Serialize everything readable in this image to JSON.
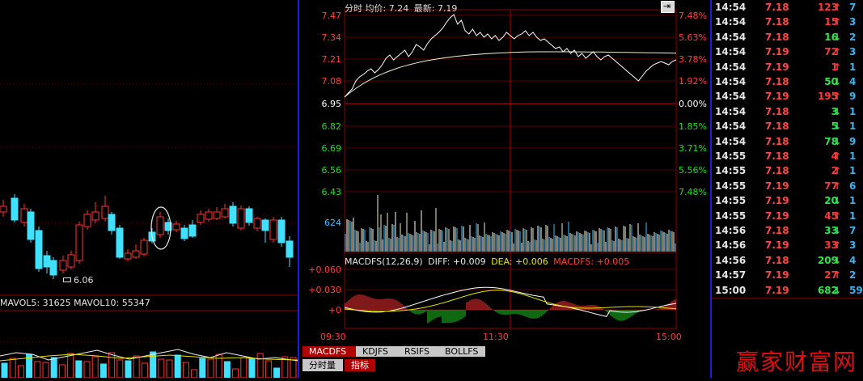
{
  "left_panel": {
    "price_label": "6.06",
    "volume_label": "MAVOL5: 31625 MAVOL10: 55347"
  },
  "intraday": {
    "header": {
      "label_fenshi": "分时",
      "avg_label": "均价:",
      "avg_value": "7.24",
      "last_label": "最新:",
      "last_value": "7.19"
    },
    "price_axis_left": [
      "7.47",
      "7.34",
      "7.21",
      "7.08",
      "6.95",
      "6.82",
      "6.69",
      "6.56",
      "6.43"
    ],
    "price_axis_right": [
      "7.48%",
      "5.63%",
      "3.78%",
      "1.92%",
      "0.00%",
      "1.85%",
      "3.71%",
      "5.56%",
      "7.48%"
    ],
    "volume_axis_label": "624",
    "macd_header": {
      "name": "MACDFS(12,26,9)",
      "diff": "DIFF: +0.009",
      "dea": "DEA: +0.006",
      "macdfs": "MACDFS: +0.005"
    },
    "macd_axis": [
      "+0.060",
      "+0.030",
      "+0"
    ],
    "time_axis": [
      "09:30",
      "11:30",
      "15:00"
    ],
    "indicator_tabs": [
      "MACDFS",
      "KDJFS",
      "RSIFS",
      "BOLLFS"
    ],
    "bottom_tabs": [
      "分时量",
      "指标"
    ],
    "colors": {
      "up": "#ff3232",
      "down": "#00e000",
      "grid": "#8a0000",
      "price_line": "#ffffff",
      "avg_line": "#ffff60"
    }
  },
  "trades": [
    {
      "time": "14:54",
      "price": "7.18",
      "vol": "123",
      "dir": "up",
      "count": "7"
    },
    {
      "time": "14:54",
      "price": "7.18",
      "vol": "15",
      "dir": "up",
      "count": "3"
    },
    {
      "time": "14:54",
      "price": "7.18",
      "vol": "16",
      "dir": "down",
      "count": "2"
    },
    {
      "time": "14:54",
      "price": "7.19",
      "vol": "72",
      "dir": "up",
      "count": "3"
    },
    {
      "time": "14:54",
      "price": "7.19",
      "vol": "1",
      "dir": "up",
      "count": "1"
    },
    {
      "time": "14:54",
      "price": "7.18",
      "vol": "50",
      "dir": "down",
      "count": "4"
    },
    {
      "time": "14:54",
      "price": "7.19",
      "vol": "195",
      "dir": "up",
      "count": "9"
    },
    {
      "time": "14:54",
      "price": "7.18",
      "vol": "3",
      "dir": "down",
      "count": "1"
    },
    {
      "time": "14:54",
      "price": "7.18",
      "vol": "5",
      "dir": "down",
      "count": "1"
    },
    {
      "time": "14:54",
      "price": "7.18",
      "vol": "78",
      "dir": "down",
      "count": "9"
    },
    {
      "time": "14:55",
      "price": "7.18",
      "vol": "4",
      "dir": "up",
      "count": "1"
    },
    {
      "time": "14:55",
      "price": "7.18",
      "vol": "2",
      "dir": "up",
      "count": "1"
    },
    {
      "time": "14:55",
      "price": "7.19",
      "vol": "77",
      "dir": "up",
      "count": "6"
    },
    {
      "time": "14:55",
      "price": "7.19",
      "vol": "20",
      "dir": "down",
      "count": "1"
    },
    {
      "time": "14:55",
      "price": "7.19",
      "vol": "45",
      "dir": "up",
      "count": "1"
    },
    {
      "time": "14:56",
      "price": "7.18",
      "vol": "33",
      "dir": "down",
      "count": "7"
    },
    {
      "time": "14:56",
      "price": "7.19",
      "vol": "33",
      "dir": "up",
      "count": "3"
    },
    {
      "time": "14:56",
      "price": "7.18",
      "vol": "209",
      "dir": "down",
      "count": "4"
    },
    {
      "time": "14:57",
      "price": "7.19",
      "vol": "27",
      "dir": "up",
      "count": "2"
    },
    {
      "time": "15:00",
      "price": "7.19",
      "vol": "682",
      "dir": "down",
      "count": "59"
    }
  ],
  "watermark": "赢家财富网"
}
